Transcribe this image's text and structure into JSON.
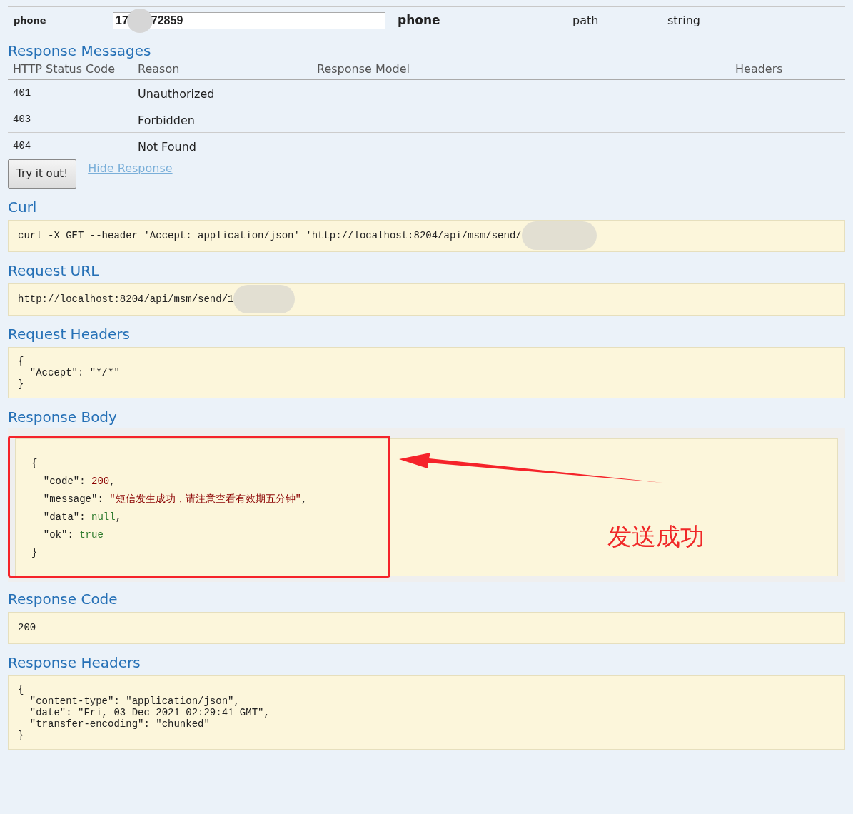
{
  "parameter_row": {
    "name": "phone",
    "value_start": "17",
    "value_end": "72859",
    "description": "phone",
    "parameter_type": "path",
    "data_type": "string"
  },
  "response_messages": {
    "title": "Response Messages",
    "columns": [
      "HTTP Status Code",
      "Reason",
      "Response Model",
      "Headers"
    ],
    "rows": [
      {
        "code": "401",
        "reason": "Unauthorized"
      },
      {
        "code": "403",
        "reason": "Forbidden"
      },
      {
        "code": "404",
        "reason": "Not Found"
      }
    ]
  },
  "try_button": "Try it out!",
  "hide_link": "Hide Response",
  "curl": {
    "title": "Curl",
    "text": "curl -X GET --header 'Accept: application/json' 'http://localhost:8204/api/msm/send/"
  },
  "request_url": {
    "title": "Request URL",
    "text": "http://localhost:8204/api/msm/send/1"
  },
  "request_headers": {
    "title": "Request Headers",
    "lines": [
      "{",
      "  \"Accept\": \"*/*\"",
      "}"
    ]
  },
  "response_body": {
    "title": "Response Body",
    "lines": [
      {
        "kind": "brace",
        "key": "{"
      },
      {
        "kind": "number",
        "key": "  \"code\": ",
        "value": "200",
        "trail": ","
      },
      {
        "kind": "string",
        "key": "  \"message\": ",
        "value": "\"短信发生成功，请注意查看有效期五分钟\"",
        "trail": ","
      },
      {
        "kind": "literal",
        "key": "  \"data\": ",
        "value": "null",
        "trail": ","
      },
      {
        "kind": "literal",
        "key": "  \"ok\": ",
        "value": "true"
      },
      {
        "kind": "brace",
        "key": "}"
      }
    ],
    "annotation": "发送成功"
  },
  "response_code": {
    "title": "Response Code",
    "text": "200"
  },
  "response_headers": {
    "title": "Response Headers",
    "lines": [
      "{",
      "  \"content-type\": \"application/json\",",
      "  \"date\": \"Fri, 03 Dec 2021 02:29:41 GMT\",",
      "  \"transfer-encoding\": \"chunked\"",
      "}"
    ]
  }
}
